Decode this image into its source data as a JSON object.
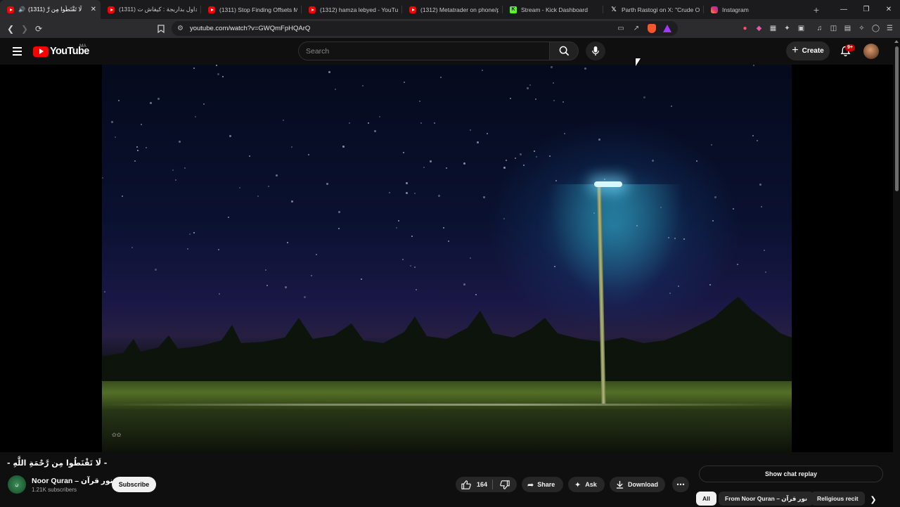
{
  "browser": {
    "tabs": [
      {
        "title": "(1311) لَا تَقْنَطُوا مِن رَّ",
        "favicon": "youtube-favicon",
        "active": true,
        "audio": true
      },
      {
        "title": "(1311) التداول بداربجة : كيفاش ت",
        "favicon": "youtube-favicon",
        "active": false
      },
      {
        "title": "(1311) Stop Finding Offsets Ma",
        "favicon": "youtube-favicon",
        "active": false
      },
      {
        "title": "(1312) hamza lebyed - YouTub",
        "favicon": "youtube-favicon",
        "active": false
      },
      {
        "title": "(1312) Metatrader on phone/p",
        "favicon": "youtube-favicon",
        "active": false
      },
      {
        "title": "Stream - Kick Dashboard",
        "favicon": "kick-favicon",
        "active": false
      },
      {
        "title": "Parth Rastogi on X: \"Crude Oil",
        "favicon": "x-favicon",
        "active": false
      },
      {
        "title": "Instagram",
        "favicon": "instagram-favicon",
        "active": false
      }
    ],
    "url": "youtube.com/watch?v=GWQmFpHQArQ"
  },
  "youtube": {
    "country_code": "MA",
    "search_placeholder": "Search",
    "create_label": "Create",
    "notification_count": "9+"
  },
  "video": {
    "title": "- لَا تَقْنَطُوا مِن رَّحْمَةِ اللَّهِ -",
    "channel_name": "Noor Quran – نور قرآن",
    "channel_subscribers": "1.21K subscribers",
    "subscribe_label": "Subscribe",
    "like_count": "164",
    "share_label": "Share",
    "ask_label": "Ask",
    "download_label": "Download"
  },
  "side_panel": {
    "chat_replay_label": "Show chat replay",
    "chips": [
      "All",
      "From Noor Quran – نور قرآن",
      "Religious recit"
    ]
  },
  "colors": {
    "youtube_red": "#ff0000",
    "background": "#0f0f0f",
    "pill_background": "#272727",
    "subscribe_background": "#f1f1f1"
  }
}
